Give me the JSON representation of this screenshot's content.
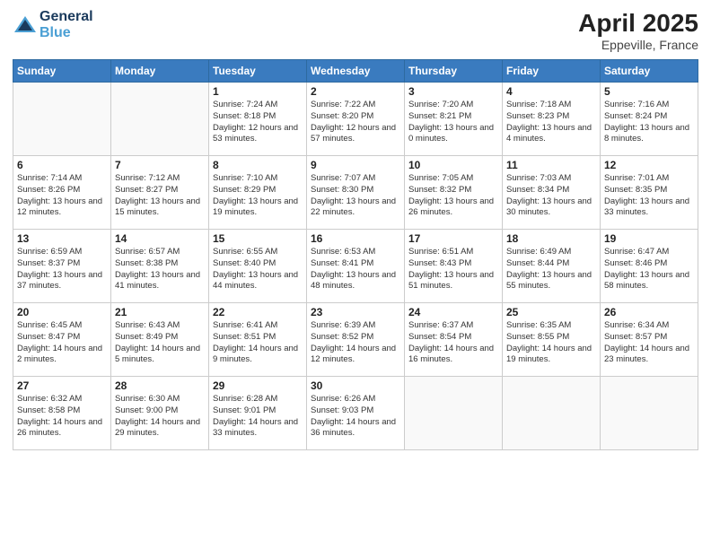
{
  "logo": {
    "line1": "General",
    "line2": "Blue"
  },
  "title": "April 2025",
  "location": "Eppeville, France",
  "days_of_week": [
    "Sunday",
    "Monday",
    "Tuesday",
    "Wednesday",
    "Thursday",
    "Friday",
    "Saturday"
  ],
  "weeks": [
    [
      {
        "day": "",
        "info": ""
      },
      {
        "day": "",
        "info": ""
      },
      {
        "day": "1",
        "info": "Sunrise: 7:24 AM\nSunset: 8:18 PM\nDaylight: 12 hours and 53 minutes."
      },
      {
        "day": "2",
        "info": "Sunrise: 7:22 AM\nSunset: 8:20 PM\nDaylight: 12 hours and 57 minutes."
      },
      {
        "day": "3",
        "info": "Sunrise: 7:20 AM\nSunset: 8:21 PM\nDaylight: 13 hours and 0 minutes."
      },
      {
        "day": "4",
        "info": "Sunrise: 7:18 AM\nSunset: 8:23 PM\nDaylight: 13 hours and 4 minutes."
      },
      {
        "day": "5",
        "info": "Sunrise: 7:16 AM\nSunset: 8:24 PM\nDaylight: 13 hours and 8 minutes."
      }
    ],
    [
      {
        "day": "6",
        "info": "Sunrise: 7:14 AM\nSunset: 8:26 PM\nDaylight: 13 hours and 12 minutes."
      },
      {
        "day": "7",
        "info": "Sunrise: 7:12 AM\nSunset: 8:27 PM\nDaylight: 13 hours and 15 minutes."
      },
      {
        "day": "8",
        "info": "Sunrise: 7:10 AM\nSunset: 8:29 PM\nDaylight: 13 hours and 19 minutes."
      },
      {
        "day": "9",
        "info": "Sunrise: 7:07 AM\nSunset: 8:30 PM\nDaylight: 13 hours and 22 minutes."
      },
      {
        "day": "10",
        "info": "Sunrise: 7:05 AM\nSunset: 8:32 PM\nDaylight: 13 hours and 26 minutes."
      },
      {
        "day": "11",
        "info": "Sunrise: 7:03 AM\nSunset: 8:34 PM\nDaylight: 13 hours and 30 minutes."
      },
      {
        "day": "12",
        "info": "Sunrise: 7:01 AM\nSunset: 8:35 PM\nDaylight: 13 hours and 33 minutes."
      }
    ],
    [
      {
        "day": "13",
        "info": "Sunrise: 6:59 AM\nSunset: 8:37 PM\nDaylight: 13 hours and 37 minutes."
      },
      {
        "day": "14",
        "info": "Sunrise: 6:57 AM\nSunset: 8:38 PM\nDaylight: 13 hours and 41 minutes."
      },
      {
        "day": "15",
        "info": "Sunrise: 6:55 AM\nSunset: 8:40 PM\nDaylight: 13 hours and 44 minutes."
      },
      {
        "day": "16",
        "info": "Sunrise: 6:53 AM\nSunset: 8:41 PM\nDaylight: 13 hours and 48 minutes."
      },
      {
        "day": "17",
        "info": "Sunrise: 6:51 AM\nSunset: 8:43 PM\nDaylight: 13 hours and 51 minutes."
      },
      {
        "day": "18",
        "info": "Sunrise: 6:49 AM\nSunset: 8:44 PM\nDaylight: 13 hours and 55 minutes."
      },
      {
        "day": "19",
        "info": "Sunrise: 6:47 AM\nSunset: 8:46 PM\nDaylight: 13 hours and 58 minutes."
      }
    ],
    [
      {
        "day": "20",
        "info": "Sunrise: 6:45 AM\nSunset: 8:47 PM\nDaylight: 14 hours and 2 minutes."
      },
      {
        "day": "21",
        "info": "Sunrise: 6:43 AM\nSunset: 8:49 PM\nDaylight: 14 hours and 5 minutes."
      },
      {
        "day": "22",
        "info": "Sunrise: 6:41 AM\nSunset: 8:51 PM\nDaylight: 14 hours and 9 minutes."
      },
      {
        "day": "23",
        "info": "Sunrise: 6:39 AM\nSunset: 8:52 PM\nDaylight: 14 hours and 12 minutes."
      },
      {
        "day": "24",
        "info": "Sunrise: 6:37 AM\nSunset: 8:54 PM\nDaylight: 14 hours and 16 minutes."
      },
      {
        "day": "25",
        "info": "Sunrise: 6:35 AM\nSunset: 8:55 PM\nDaylight: 14 hours and 19 minutes."
      },
      {
        "day": "26",
        "info": "Sunrise: 6:34 AM\nSunset: 8:57 PM\nDaylight: 14 hours and 23 minutes."
      }
    ],
    [
      {
        "day": "27",
        "info": "Sunrise: 6:32 AM\nSunset: 8:58 PM\nDaylight: 14 hours and 26 minutes."
      },
      {
        "day": "28",
        "info": "Sunrise: 6:30 AM\nSunset: 9:00 PM\nDaylight: 14 hours and 29 minutes."
      },
      {
        "day": "29",
        "info": "Sunrise: 6:28 AM\nSunset: 9:01 PM\nDaylight: 14 hours and 33 minutes."
      },
      {
        "day": "30",
        "info": "Sunrise: 6:26 AM\nSunset: 9:03 PM\nDaylight: 14 hours and 36 minutes."
      },
      {
        "day": "",
        "info": ""
      },
      {
        "day": "",
        "info": ""
      },
      {
        "day": "",
        "info": ""
      }
    ]
  ]
}
